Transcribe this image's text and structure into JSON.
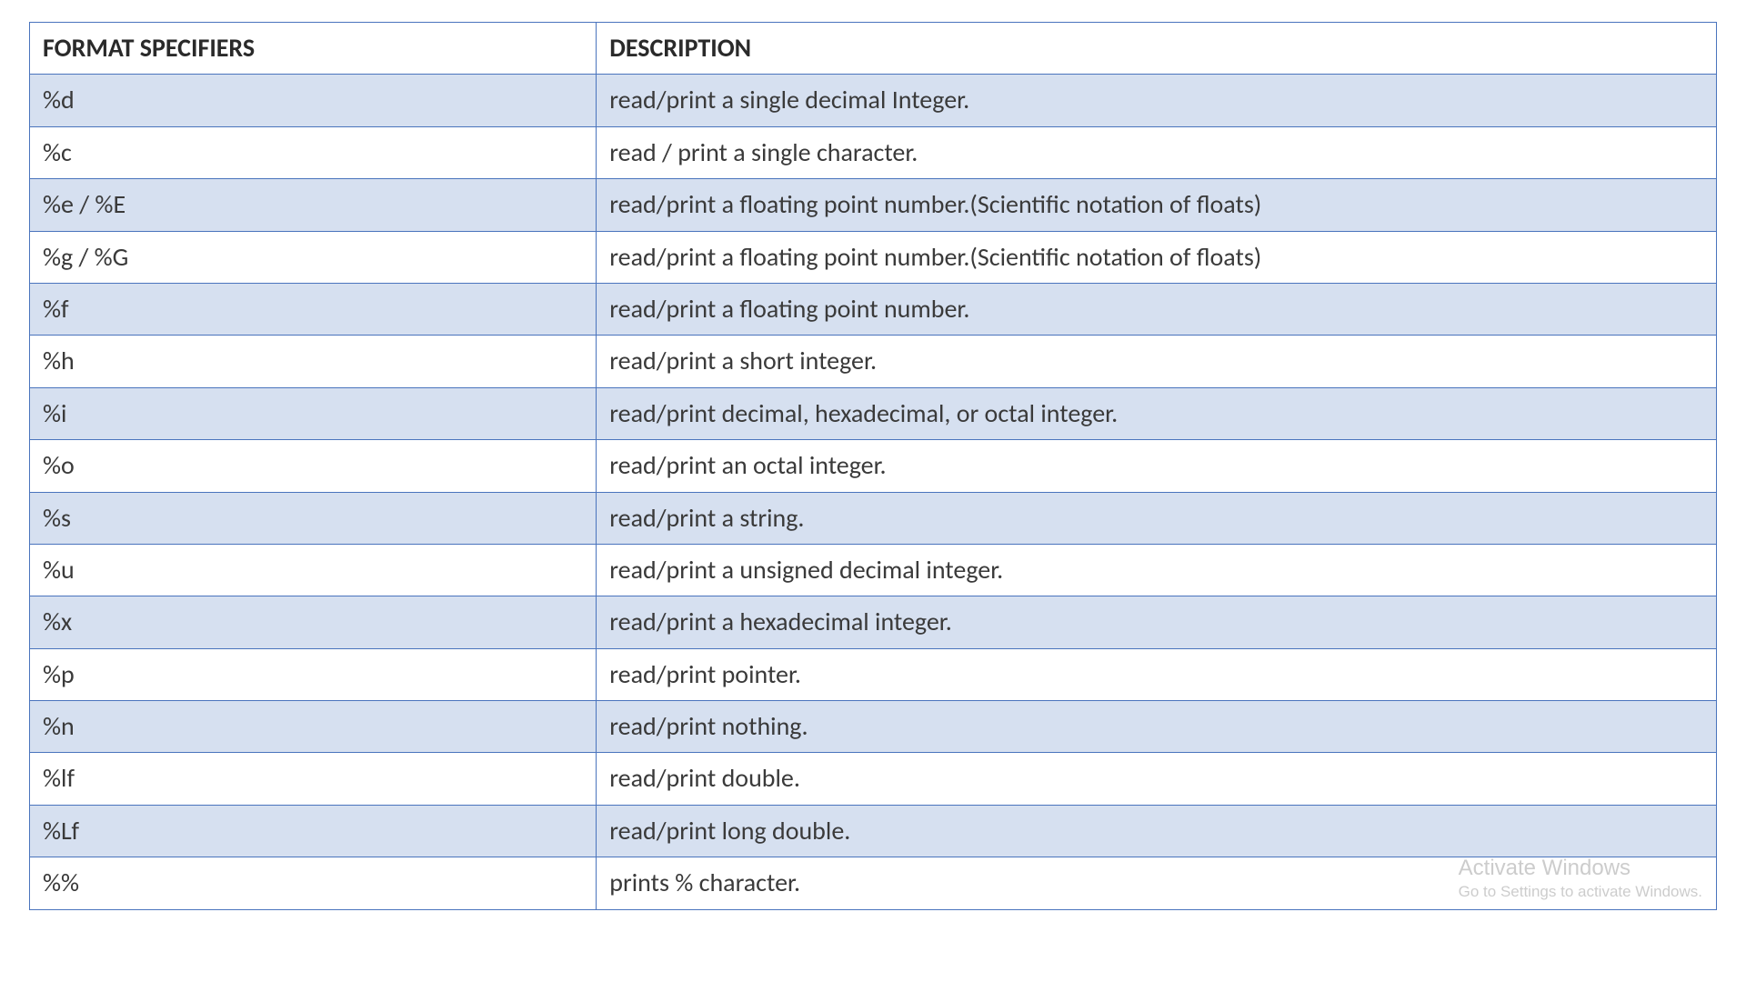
{
  "table": {
    "headers": {
      "col1": "FORMAT SPECIFIERS",
      "col2": "DESCRIPTION"
    },
    "rows": [
      {
        "spec": "%d",
        "desc": "read/print a single decimal Integer."
      },
      {
        "spec": "%c",
        "desc": "read / print a single character."
      },
      {
        "spec": "%e / %E",
        "desc": "read/print a floating point number.(Scientific notation of floats)"
      },
      {
        "spec": "%g / %G",
        "desc": "read/print a floating point number.(Scientific notation of floats)"
      },
      {
        "spec": "%f",
        "desc": "read/print a floating point number."
      },
      {
        "spec": "%h",
        "desc": "read/print a short integer."
      },
      {
        "spec": "%i",
        "desc": "read/print decimal, hexadecimal, or octal integer."
      },
      {
        "spec": "%o",
        "desc": "read/print an octal integer."
      },
      {
        "spec": "%s",
        "desc": "read/print a string."
      },
      {
        "spec": "%u",
        "desc": "read/print a unsigned decimal integer."
      },
      {
        "spec": "%x",
        "desc": "read/print a hexadecimal integer."
      },
      {
        "spec": "%p",
        "desc": "read/print pointer."
      },
      {
        "spec": "%n",
        "desc": "read/print nothing."
      },
      {
        "spec": "%lf",
        "desc": "read/print double."
      },
      {
        "spec": "%Lf",
        "desc": "read/print long double."
      },
      {
        "spec": "%%",
        "desc": "prints % character."
      }
    ]
  },
  "watermark": {
    "title": "Activate Windows",
    "sub": "Go to Settings to activate Windows."
  }
}
